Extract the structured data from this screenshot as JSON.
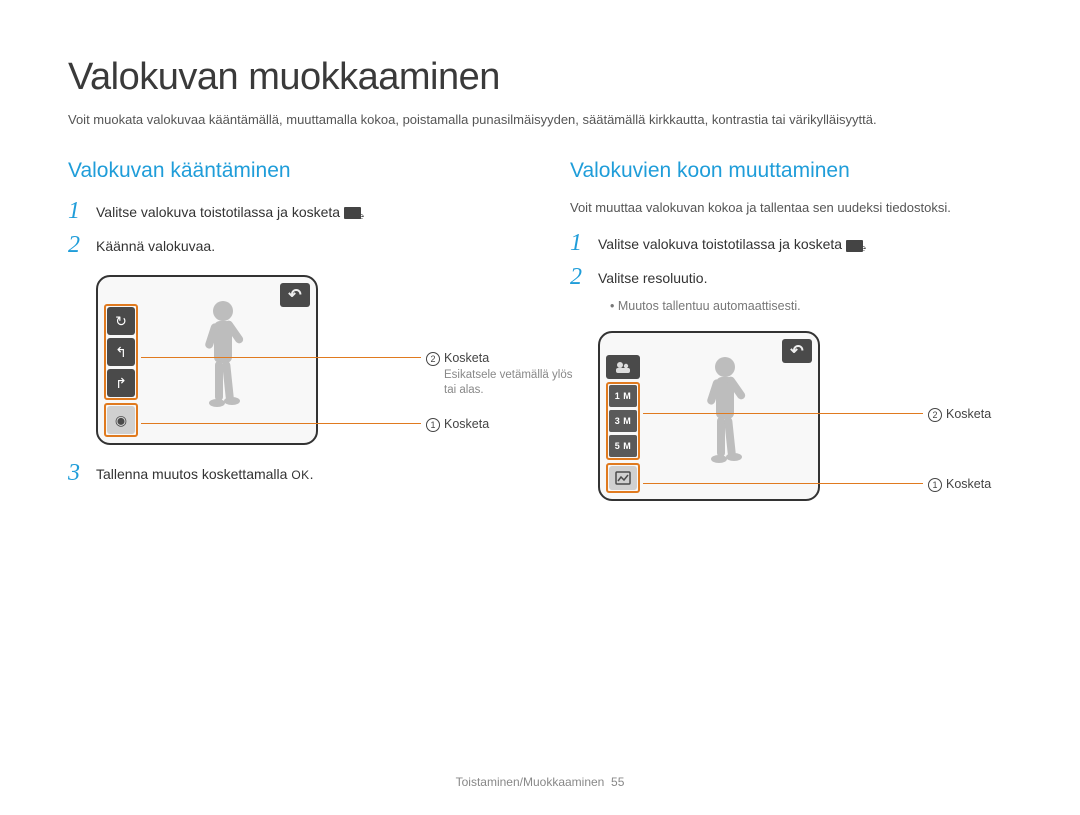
{
  "page": {
    "title": "Valokuvan muokkaaminen",
    "intro": "Voit muokata valokuvaa kääntämällä, muuttamalla kokoa, poistamalla punasilmäisyyden, säätämällä kirkkautta, kontrastia tai värikylläisyyttä."
  },
  "left": {
    "heading": "Valokuvan kääntäminen",
    "step1": "Valitse valokuva toistotilassa ja kosketa ",
    "step2": "Käännä valokuvaa.",
    "step3_a": "Tallenna muutos koskettamalla ",
    "step3_b": "OK",
    "callout_touch": "Kosketa",
    "callout_preview": "Esikatsele vetämällä ylös tai alas."
  },
  "right": {
    "heading": "Valokuvien koon muuttaminen",
    "sub": "Voit muuttaa valokuvan kokoa ja tallentaa sen uudeksi tiedostoksi.",
    "step1": "Valitse valokuva toistotilassa ja kosketa ",
    "step2": "Valitse resoluutio.",
    "bullet": "Muutos tallentuu automaattisesti.",
    "callout_touch": "Kosketa",
    "res": {
      "r1": "1 M",
      "r2": "3 M",
      "r3": "5 M"
    }
  },
  "nums": {
    "n1": "1",
    "n2": "2",
    "n3": "3",
    "c1": "1",
    "c2": "2"
  },
  "footer": {
    "section": "Toistaminen/Muokkaaminen",
    "page": "55"
  }
}
